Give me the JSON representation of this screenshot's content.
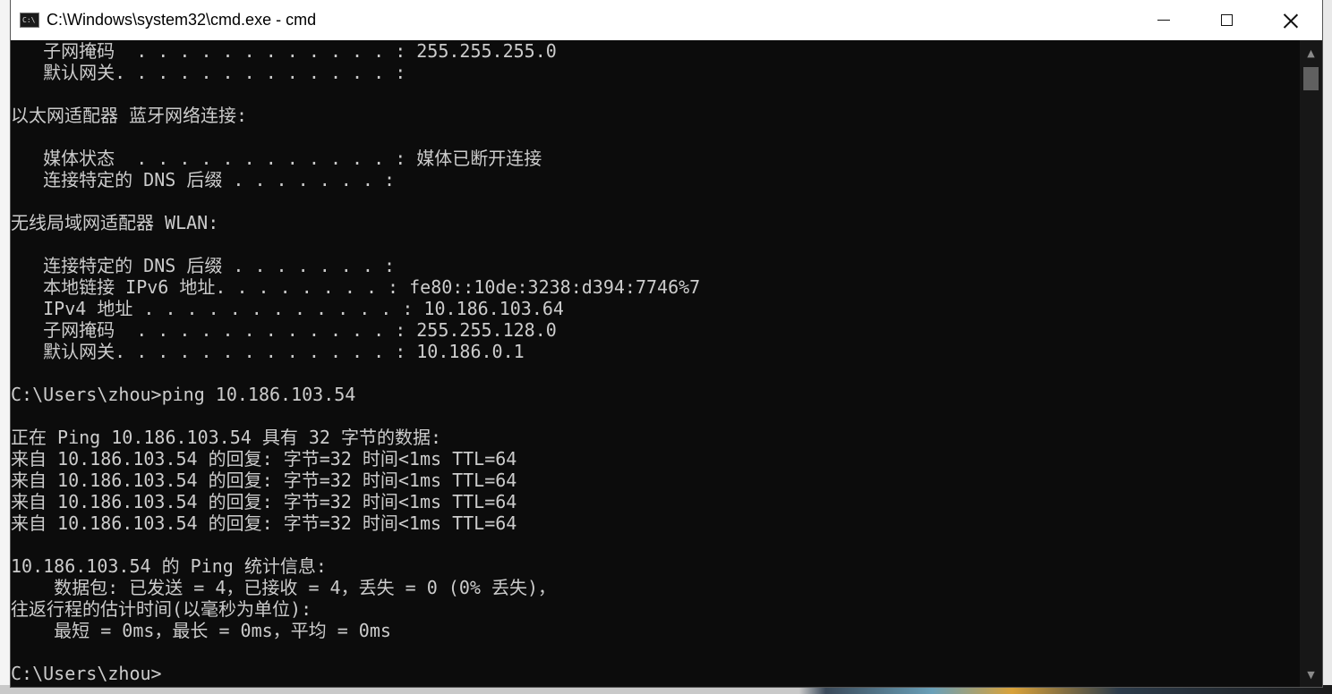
{
  "window": {
    "title": "C:\\Windows\\system32\\cmd.exe - cmd",
    "icon": "console-icon",
    "icon_text": "C:\\",
    "controls": {
      "minimize": "minimize-icon",
      "maximize": "maximize-icon",
      "close": "close-icon"
    }
  },
  "console": {
    "background": "#0c0c0c",
    "foreground": "#cccccc",
    "lines": [
      "   子网掩码  . . . . . . . . . . . . : 255.255.255.0",
      "   默认网关. . . . . . . . . . . . . :",
      "",
      "以太网适配器 蓝牙网络连接:",
      "",
      "   媒体状态  . . . . . . . . . . . . : 媒体已断开连接",
      "   连接特定的 DNS 后缀 . . . . . . . :",
      "",
      "无线局域网适配器 WLAN:",
      "",
      "   连接特定的 DNS 后缀 . . . . . . . :",
      "   本地链接 IPv6 地址. . . . . . . . : fe80::10de:3238:d394:7746%7",
      "   IPv4 地址 . . . . . . . . . . . . : 10.186.103.64",
      "   子网掩码  . . . . . . . . . . . . : 255.255.128.0",
      "   默认网关. . . . . . . . . . . . . : 10.186.0.1",
      "",
      "C:\\Users\\zhou>ping 10.186.103.54",
      "",
      "正在 Ping 10.186.103.54 具有 32 字节的数据:",
      "来自 10.186.103.54 的回复: 字节=32 时间<1ms TTL=64",
      "来自 10.186.103.54 的回复: 字节=32 时间<1ms TTL=64",
      "来自 10.186.103.54 的回复: 字节=32 时间<1ms TTL=64",
      "来自 10.186.103.54 的回复: 字节=32 时间<1ms TTL=64",
      "",
      "10.186.103.54 的 Ping 统计信息:",
      "    数据包: 已发送 = 4，已接收 = 4，丢失 = 0 (0% 丢失)，",
      "往返行程的估计时间(以毫秒为单位):",
      "    最短 = 0ms，最长 = 0ms，平均 = 0ms",
      "",
      "C:\\Users\\zhou>"
    ]
  },
  "scrollbar": {
    "up": "chevron-up-icon",
    "down": "chevron-down-icon",
    "up_glyph": "▲",
    "down_glyph": "▼"
  }
}
